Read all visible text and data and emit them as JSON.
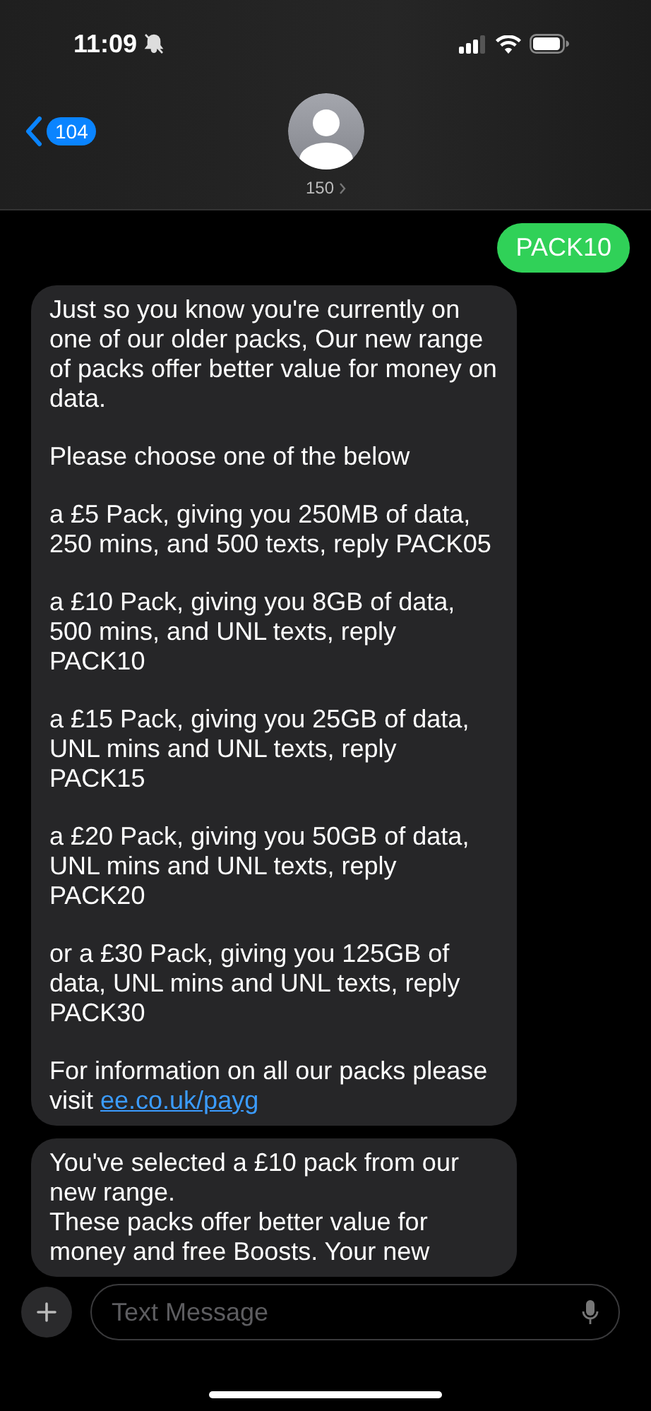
{
  "status_bar": {
    "time": "11:09"
  },
  "header": {
    "back_badge": "104",
    "contact": "150"
  },
  "messages": [
    {
      "kind": "sent",
      "paragraphs": [
        "PACK10"
      ]
    },
    {
      "kind": "received",
      "paragraphs": [
        "Just so you know you're currently on one of our older packs, Our new range of packs offer better value for money on data.",
        "Please choose one of the below",
        "a £5 Pack, giving you 250MB of data, 250 mins, and 500 texts, reply PACK05",
        "a £10 Pack, giving you 8GB of data, 500 mins, and UNL texts, reply PACK10",
        "a £15 Pack, giving you 25GB of data, UNL mins and UNL texts, reply PACK15",
        "a £20 Pack, giving you 50GB of data, UNL mins and UNL texts, reply PACK20",
        "or a £30 Pack, giving you 125GB of data, UNL mins and UNL texts, reply PACK30",
        "For information on all our packs please visit"
      ],
      "link": "ee.co.uk/payg"
    },
    {
      "kind": "received",
      "paragraphs": [
        "You've selected a £10 pack from our new range.\nThese packs offer better value for money and free Boosts. Your new"
      ]
    }
  ],
  "composer": {
    "placeholder": "Text Message"
  }
}
